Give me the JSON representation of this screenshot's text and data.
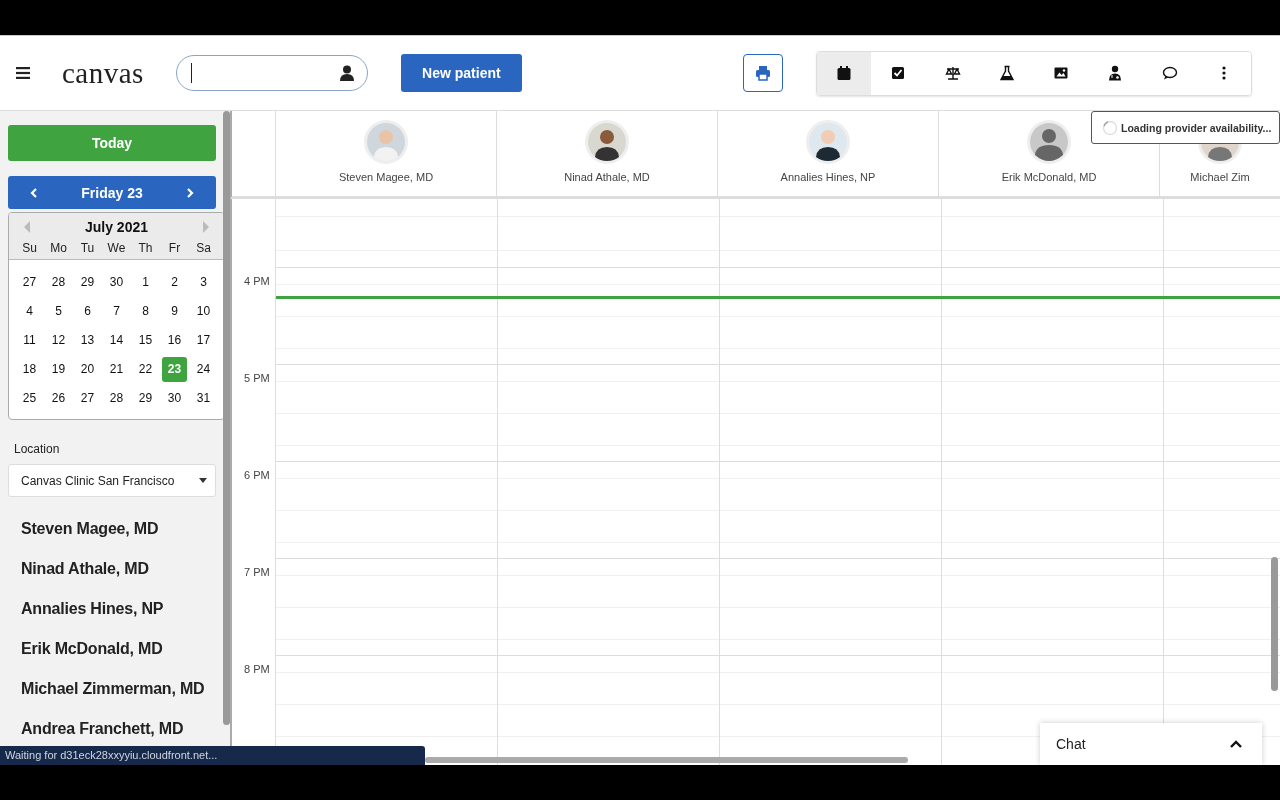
{
  "header": {
    "logo": "canvas",
    "new_patient_button": "New patient",
    "tabs": [
      {
        "selected": true
      },
      {
        "selected": false
      },
      {
        "selected": false
      },
      {
        "selected": false
      },
      {
        "selected": false
      },
      {
        "selected": false
      },
      {
        "selected": false
      },
      {
        "selected": false
      }
    ]
  },
  "sidebar": {
    "today_button": "Today",
    "date_nav": "Friday 23",
    "mini_calendar": {
      "month": "July 2021",
      "weekdays": [
        "Su",
        "Mo",
        "Tu",
        "We",
        "Th",
        "Fr",
        "Sa"
      ],
      "weeks": [
        [
          {
            "day": "27",
            "selected": false
          },
          {
            "day": "28",
            "selected": false
          },
          {
            "day": "29",
            "selected": false
          },
          {
            "day": "30",
            "selected": false
          },
          {
            "day": "1",
            "selected": false
          },
          {
            "day": "2",
            "selected": false
          },
          {
            "day": "3",
            "selected": false
          }
        ],
        [
          {
            "day": "4",
            "selected": false
          },
          {
            "day": "5",
            "selected": false
          },
          {
            "day": "6",
            "selected": false
          },
          {
            "day": "7",
            "selected": false
          },
          {
            "day": "8",
            "selected": false
          },
          {
            "day": "9",
            "selected": false
          },
          {
            "day": "10",
            "selected": false
          }
        ],
        [
          {
            "day": "11",
            "selected": false
          },
          {
            "day": "12",
            "selected": false
          },
          {
            "day": "13",
            "selected": false
          },
          {
            "day": "14",
            "selected": false
          },
          {
            "day": "15",
            "selected": false
          },
          {
            "day": "16",
            "selected": false
          },
          {
            "day": "17",
            "selected": false
          }
        ],
        [
          {
            "day": "18",
            "selected": false
          },
          {
            "day": "19",
            "selected": false
          },
          {
            "day": "20",
            "selected": false
          },
          {
            "day": "21",
            "selected": false
          },
          {
            "day": "22",
            "selected": false
          },
          {
            "day": "23",
            "selected": true
          },
          {
            "day": "24",
            "selected": false
          }
        ],
        [
          {
            "day": "25",
            "selected": false
          },
          {
            "day": "26",
            "selected": false
          },
          {
            "day": "27",
            "selected": false
          },
          {
            "day": "28",
            "selected": false
          },
          {
            "day": "29",
            "selected": false
          },
          {
            "day": "30",
            "selected": false
          },
          {
            "day": "31",
            "selected": false
          }
        ]
      ]
    },
    "location_label": "Location",
    "location_value": "Canvas Clinic San Francisco",
    "providers": [
      "Steven Magee, MD",
      "Ninad Athale, MD",
      "Annalies Hines, NP",
      "Erik McDonald, MD",
      "Michael Zimmerman, MD",
      "Andrea Franchett, MD"
    ]
  },
  "schedule": {
    "columns": [
      {
        "name": "Steven Magee, MD"
      },
      {
        "name": "Ninad Athale, MD"
      },
      {
        "name": "Annalies Hines, NP"
      },
      {
        "name": "Erik McDonald, MD",
        "avatar": {
          "kind": "silhouette"
        }
      },
      {
        "name": "Michael Zim"
      }
    ],
    "hours": [
      "4 PM",
      "5 PM",
      "6 PM",
      "7 PM",
      "8 PM"
    ]
  },
  "loading_toast": "Loading provider availability...",
  "chat": {
    "label": "Chat"
  },
  "status_bar": "Waiting for d31eck28xxyyiu.cloudfront.net..."
}
